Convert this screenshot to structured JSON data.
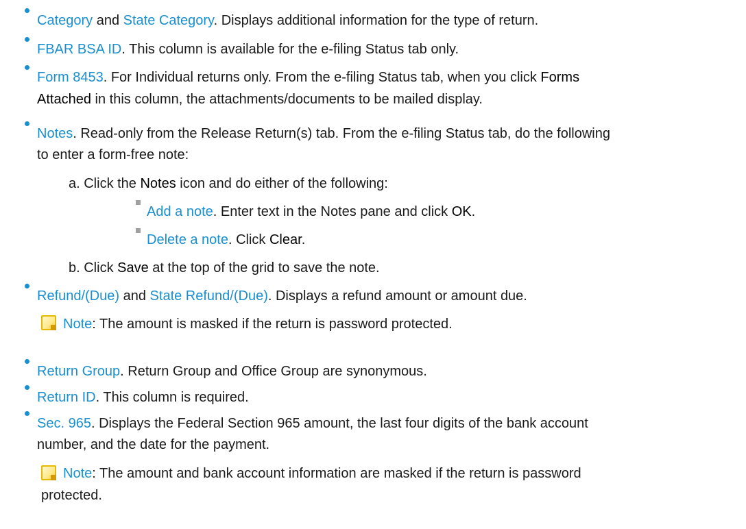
{
  "items": {
    "category": {
      "t1": "Category",
      "t2": " and ",
      "t3": "State Category",
      "t4": ". Displays additional information for the type of return."
    },
    "fbar": {
      "t1": "FBAR BSA ID",
      "t2": ". This column is available for the e-filing Status tab only."
    },
    "form8453": {
      "t1": "Form 8453",
      "t2": ". For Individual returns only. From the e-filing Status tab, when you click ",
      "t3": "Forms",
      "l2a": "Attached",
      "l2b": " in this column, the attachments/documents to be mailed display."
    },
    "notes": {
      "t1": "Notes",
      "t2": ". Read-only from the Release Return(s) tab. From the e-filing Status tab, do the following",
      "l2": "to enter a form-free note:",
      "a": {
        "p1": "a.  Click the ",
        "p2": "Notes",
        "p3": " icon and do either of the following:"
      },
      "add": {
        "p1": "Add a note",
        "p2": ". Enter text in the Notes pane and click ",
        "p3": "OK",
        "p4": "."
      },
      "del": {
        "p1": "Delete a note",
        "p2": ". Click ",
        "p3": "Clear",
        "p4": "."
      },
      "b": {
        "p1": "b.  Click ",
        "p2": "Save",
        "p3": " at the top of the grid to save the note."
      }
    },
    "refund": {
      "t1": "Refund/(Due)",
      "t2": " and ",
      "t3": "State Refund/(Due)",
      "t4": ". Displays a refund amount or amount due.",
      "note_label": "Note",
      "note_text": ": The amount is masked if the return is password protected."
    },
    "returngroup": {
      "t1": "Return Group",
      "t2": ". Return Group and Office Group are synonymous."
    },
    "returnid": {
      "t1": "Return ID",
      "t2": ". This column is required."
    },
    "sec965": {
      "t1": "Sec. 965",
      "t2": ". Displays the Federal Section 965 amount, the last four digits of the bank account",
      "l2": "number, and the date for the payment.",
      "note_label": "Note",
      "note_text": ": The amount and bank account information are masked if the return is password",
      "note_l2": "protected."
    }
  }
}
